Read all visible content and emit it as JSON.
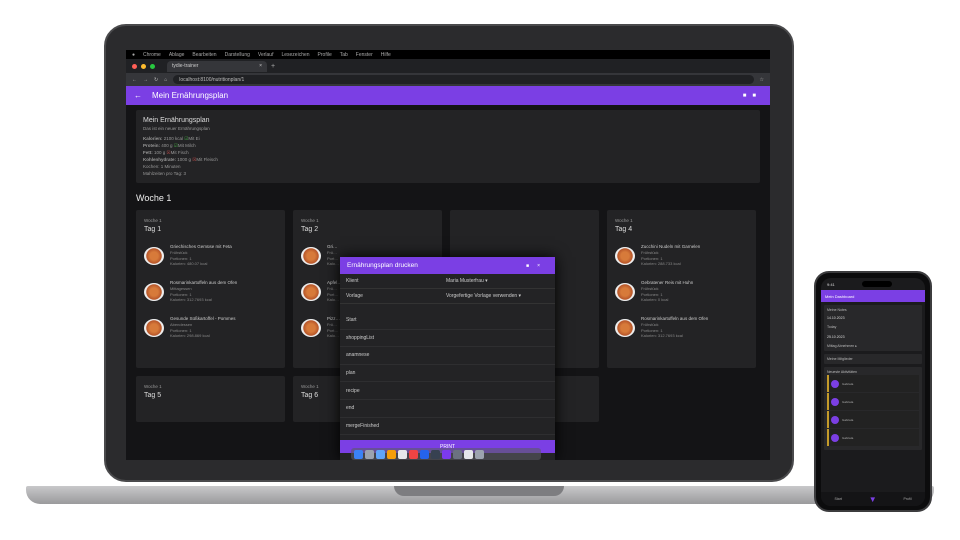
{
  "browser": {
    "tab_title": "tydie-trainer",
    "url": "localhost:8100/nutritionplan/1",
    "mac_menu": [
      "Chrome",
      "Ablage",
      "Bearbeiten",
      "Darstellung",
      "Verlauf",
      "Lesezeichen",
      "Profile",
      "Tab",
      "Fenster",
      "Hilfe"
    ]
  },
  "app": {
    "title": "Mein Ernährungsplan",
    "info": {
      "heading": "Mein Ernährungsplan",
      "subtitle": "Das ist ein neuer Ernährungsplan",
      "rows": [
        {
          "label": "Kalorien:",
          "value": "2100 kcal",
          "flag": "Mit Ei"
        },
        {
          "label": "Protein:",
          "value": "400 g",
          "flag": "Mit Milch"
        },
        {
          "label": "Fett:",
          "value": "100 g",
          "flag": "Mit Fisch"
        },
        {
          "label": "Kohlenhydrate:",
          "value": "1000 g",
          "flag": "Mit Fleisch"
        }
      ],
      "cooking": "Kochen: 1 Minuten",
      "meals_per_day": "Mahlzeiten pro Tag: 3"
    },
    "week_title": "Woche 1",
    "days": [
      {
        "week": "Woche 1",
        "name": "Tag 1",
        "meals": [
          {
            "title": "Griechisches Gemüse mit Feta",
            "type": "Frühstück",
            "portions": "Portionen: 1",
            "kcal": "Kalorien: 480.07 kcal"
          },
          {
            "title": "Rosmarinkartoffeln aus dem Ofen",
            "type": "Mittagessen",
            "portions": "Portionen: 1",
            "kcal": "Kalorien: 312.7693 kcal"
          },
          {
            "title": "Gesunde Süßkartoffel - Pommes",
            "type": "Abendessen",
            "portions": "Portionen: 1",
            "kcal": "Kalorien: 298.869 kcal"
          }
        ]
      },
      {
        "week": "Woche 1",
        "name": "Tag 2",
        "meals": [
          {
            "title": "Gri…",
            "type": "Frü…",
            "portions": "Port…",
            "kcal": "Kalo…"
          },
          {
            "title": "Apfel…",
            "type": "Frü…",
            "portions": "Port…",
            "kcal": "Kalo…"
          },
          {
            "title": "Pizz…",
            "type": "Frü…",
            "portions": "Port…",
            "kcal": "Kalo…"
          }
        ]
      },
      {
        "week": "",
        "name": "",
        "meals": []
      },
      {
        "week": "Woche 1",
        "name": "Tag 4",
        "meals": [
          {
            "title": "Zucchini Nudeln mit Garnelen",
            "type": "Frühstück",
            "portions": "Portionen: 1",
            "kcal": "Kalorien: 288.733 kcal"
          },
          {
            "title": "Gebratener Reis mit Huhn",
            "type": "Frühstück",
            "portions": "Portionen: 1",
            "kcal": "Kalorien: 0 kcal"
          },
          {
            "title": "Rosmarinkartoffeln aus dem Ofen",
            "type": "Frühstück",
            "portions": "Portionen: 1",
            "kcal": "Kalorien: 312.7693 kcal"
          }
        ]
      }
    ],
    "days_row2": [
      {
        "week": "Woche 1",
        "name": "Tag 5"
      },
      {
        "week": "Woche 1",
        "name": "Tag 6"
      }
    ],
    "modal": {
      "title": "Ernährungsplan drucken",
      "client_label": "Klient",
      "client_value": "Maria Musterfrau ▾",
      "template_label": "Vorlage",
      "template_value": "Vorgefertige Vorlage verwenden ▾",
      "steps": [
        "Start",
        "shoppingList",
        "anamnese",
        "plan",
        "recipe",
        "end",
        "mergeFinished"
      ],
      "print_label": "PRINT"
    }
  },
  "phone": {
    "time": "9:41",
    "app_title": "Mein Dashboard",
    "section1": "Meine Notes",
    "date1": "14.10.2023",
    "entry1": "Today",
    "date2": "25.10.2023",
    "entry2": "Mittag Abnehmen ▸",
    "more": "Meine Mitglieder",
    "section2": "Neueste Aktivitäten",
    "activity_name": "Gabriela",
    "nav_left": "Start",
    "nav_right": "Profil"
  },
  "colors": {
    "accent": "#7b3fe4",
    "dark_bg": "#141416",
    "card": "#232325"
  }
}
